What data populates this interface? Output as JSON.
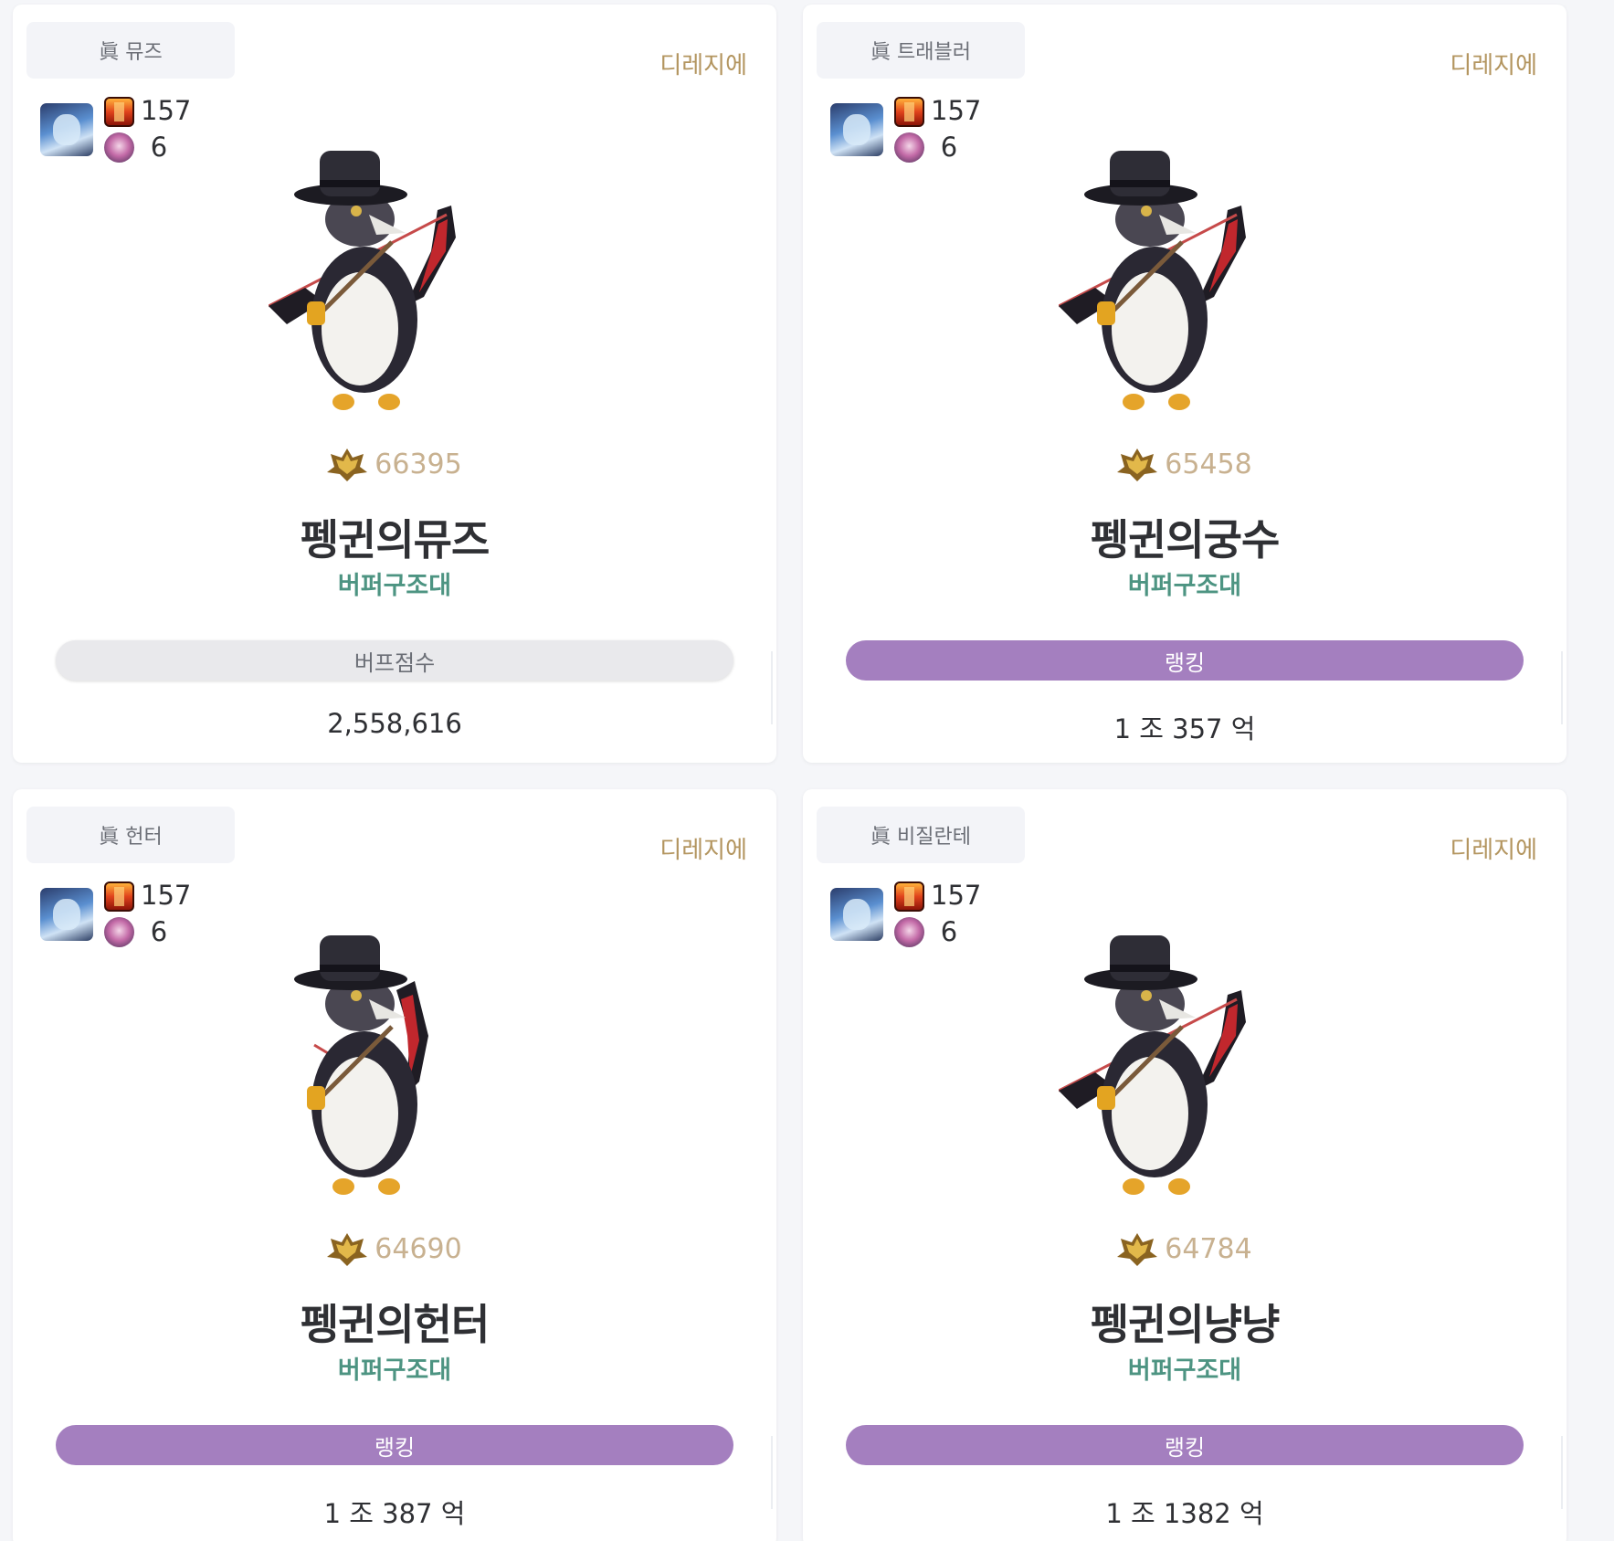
{
  "cards": [
    {
      "job": "眞 뮤즈",
      "server": "디레지에",
      "rune_level": "157",
      "pet_value": "6",
      "fame": "66395",
      "name": "펭귄의뮤즈",
      "guild": "버퍼구조대",
      "pill_label": "버프점수",
      "pill_style": "buff",
      "score": "2,558,616"
    },
    {
      "job": "眞 트래블러",
      "server": "디레지에",
      "rune_level": "157",
      "pet_value": "6",
      "fame": "65458",
      "name": "펭귄의궁수",
      "guild": "버퍼구조대",
      "pill_label": "랭킹",
      "pill_style": "rank",
      "score": "1 조 357 억"
    },
    {
      "job": "眞 헌터",
      "server": "디레지에",
      "rune_level": "157",
      "pet_value": "6",
      "fame": "64690",
      "name": "펭귄의헌터",
      "guild": "버퍼구조대",
      "pill_label": "랭킹",
      "pill_style": "rank",
      "score": "1 조 387 억"
    },
    {
      "job": "眞 비질란테",
      "server": "디레지에",
      "rune_level": "157",
      "pet_value": "6",
      "fame": "64784",
      "name": "펭귄의냥냥",
      "guild": "버퍼구조대",
      "pill_label": "랭킹",
      "pill_style": "rank",
      "score": "1 조 1382 억"
    }
  ],
  "colors": {
    "server": "#b3955f",
    "guild": "#4d9482",
    "rank_pill": "#a47fbf",
    "buff_pill": "#e9e9ec",
    "fame": "#c8b190"
  },
  "icons": {
    "avatar": "character-portrait-icon",
    "rune": "rune-book-icon",
    "pet": "creature-icon",
    "fame": "fame-crest-icon"
  }
}
